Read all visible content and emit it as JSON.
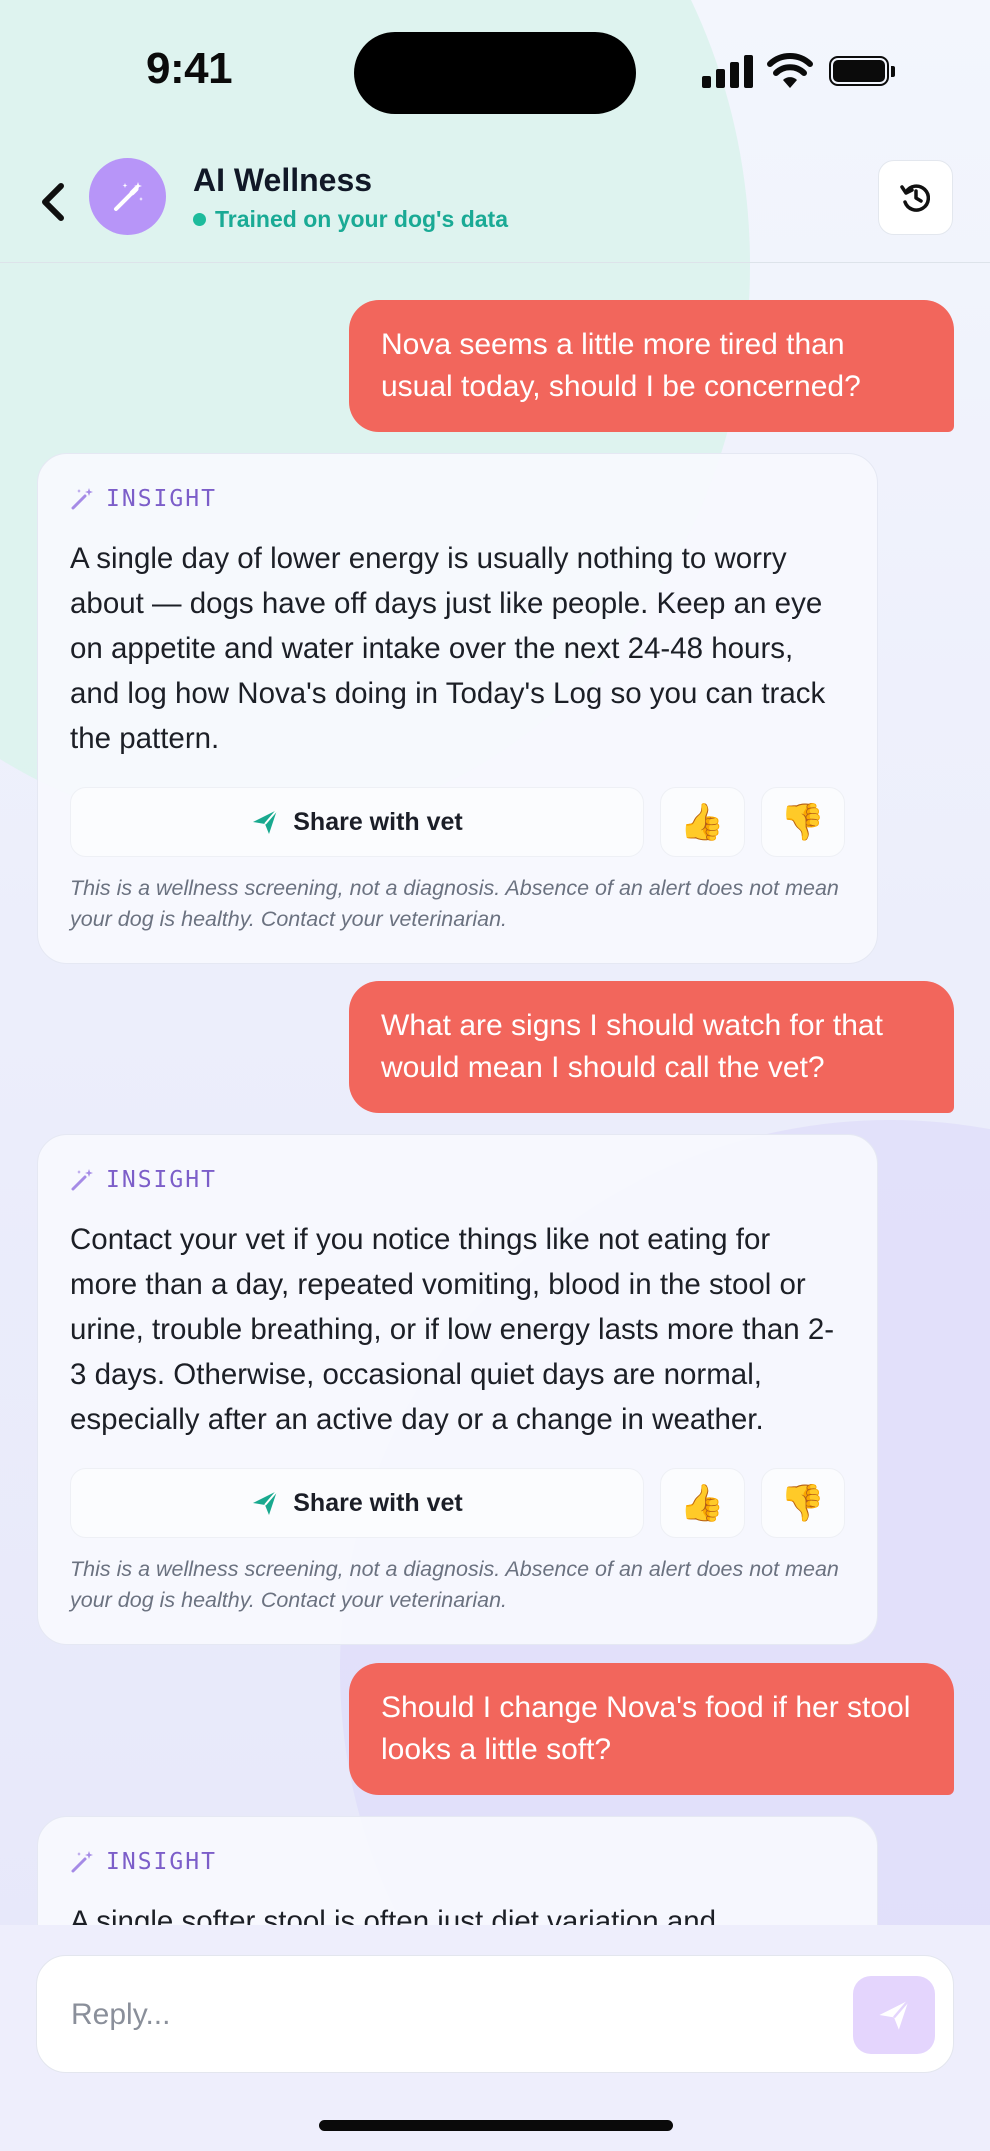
{
  "status_bar": {
    "time": "9:41"
  },
  "header": {
    "title": "AI Wellness",
    "subtitle": "Trained on your dog's data",
    "avatar_icon": "magic-wand-icon",
    "back_icon": "chevron-left-icon",
    "history_icon": "history-icon"
  },
  "colors": {
    "user_bubble": "#f2665c",
    "accent_purple": "#b795f8",
    "accent_teal": "#1aaa95",
    "insight_label": "#7c5ec9"
  },
  "messages": [
    {
      "role": "user",
      "text": "Nova seems a little more tired than usual today, should I be concerned?"
    },
    {
      "role": "ai",
      "label": "INSIGHT",
      "text": "A single day of lower energy is usually nothing to worry about — dogs have off days just like people. Keep an eye on appetite and water intake over the next 24-48 hours, and log how Nova's doing in Today's Log so you can track the pattern.",
      "share_label": "Share with vet",
      "thumbs_up": "👍",
      "thumbs_down": "👎",
      "disclaimer": "This is a wellness screening, not a diagnosis. Absence of an alert does not mean your dog is healthy. Contact your veterinarian."
    },
    {
      "role": "user",
      "text": "What are signs I should watch for that would mean I should call the vet?"
    },
    {
      "role": "ai",
      "label": "INSIGHT",
      "text": "Contact your vet if you notice things like not eating for more than a day, repeated vomiting, blood in the stool or urine, trouble breathing, or if low energy lasts more than 2-3 days. Otherwise, occasional quiet days are normal, especially after an active day or a change in weather.",
      "share_label": "Share with vet",
      "thumbs_up": "👍",
      "thumbs_down": "👎",
      "disclaimer": "This is a wellness screening, not a diagnosis. Absence of an alert does not mean your dog is healthy. Contact your veterinarian."
    },
    {
      "role": "user",
      "text": "Should I change Nova's food if her stool looks a little soft?"
    },
    {
      "role": "ai",
      "label": "INSIGHT",
      "text": "A single softer stool is often just diet variation and"
    }
  ],
  "composer": {
    "placeholder": "Reply...",
    "send_icon": "send-icon"
  }
}
